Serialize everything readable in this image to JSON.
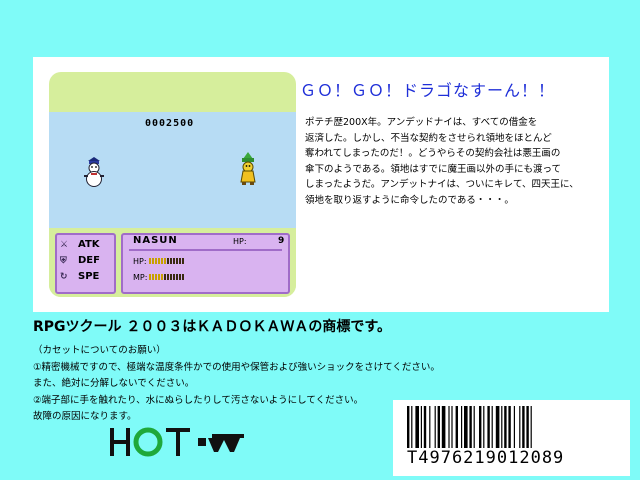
{
  "game_screen": {
    "score": "0002500",
    "commands": [
      {
        "icon": "sword-icon",
        "label": "ATK"
      },
      {
        "icon": "shield-icon",
        "label": "DEF"
      },
      {
        "icon": "speed-icon",
        "label": "SPE"
      }
    ],
    "character": {
      "name": "NASUN",
      "hp_label": "HP:",
      "hp_value": "9",
      "hp_bar_label": "HP:",
      "mp_bar_label": "MP:",
      "hp_fill": 0.5,
      "mp_fill": 0.45
    }
  },
  "title": "ＧＯ！ＧＯ！ドラゴなすーん！！",
  "description_lines": [
    "ポテチ歴200X年。アンデッドナイは、すべての借金を",
    "返済した。しかし、不当な契約をさせられ領地をほとんど",
    "奪われてしまったのだ！。どうやらその契約会社は悪王画の",
    "傘下のようである。領地はすでに魔王画以外の手にも渡って",
    "しまったようだ。アンデットナイは、ついにキレて、四天王に、",
    "領地を取り返すように命令したのである・・・。"
  ],
  "trademark": "RPGツクール ２００３はＫＡＤＯＫＡＷＡの商標です。",
  "notice_lines": [
    "（カセットについてのお願い）",
    "①精密機械ですので、極端な温度条件かでの使用や保管および強いショックをさけてください。",
    "また、絶対に分解しないでください。",
    "②端子部に手を触れたり、水にぬらしたりして汚さないようにしてください。",
    "故障の原因になります。"
  ],
  "logo_text": "HOT・",
  "barcode_number": "T4976219012089",
  "colors": {
    "background": "#7ffbf8",
    "title": "#1f2fd8",
    "panel": "#d9b3f0",
    "panel_border": "#a06cc8",
    "screen_top": "#d6ee9c",
    "field": "#b7dcf4",
    "logo_green": "#1fa83a"
  }
}
